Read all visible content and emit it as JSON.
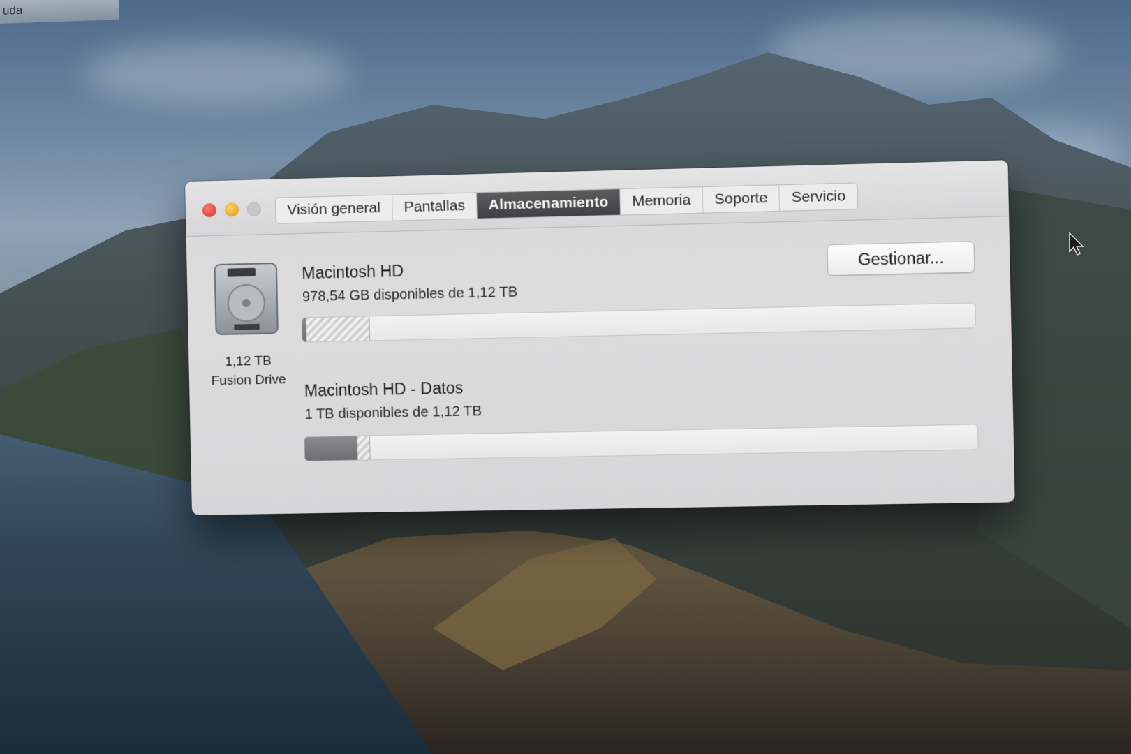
{
  "desktop": {
    "menu_fragment": "uda"
  },
  "window": {
    "tabs": [
      {
        "label": "Visión general",
        "active": false
      },
      {
        "label": "Pantallas",
        "active": false
      },
      {
        "label": "Almacenamiento",
        "active": true
      },
      {
        "label": "Memoria",
        "active": false
      },
      {
        "label": "Soporte",
        "active": false
      },
      {
        "label": "Servicio",
        "active": false
      }
    ],
    "disk": {
      "icon": "hard-drive-icon",
      "capacity": "1,12 TB",
      "type": "Fusion Drive"
    },
    "manage_label": "Gestionar...",
    "volumes": [
      {
        "name": "Macintosh HD",
        "available": "978,54 GB disponibles de 1,12 TB",
        "used_fraction": 0.0,
        "other_fraction": 0.095
      },
      {
        "name": "Macintosh HD - Datos",
        "available": "1 TB disponibles de 1,12 TB",
        "used_fraction": 0.08,
        "other_fraction": 0.018
      }
    ]
  },
  "colors": {
    "close": "#e0443a",
    "minimize": "#e3a522",
    "tab_active": "#4a4a4c"
  }
}
